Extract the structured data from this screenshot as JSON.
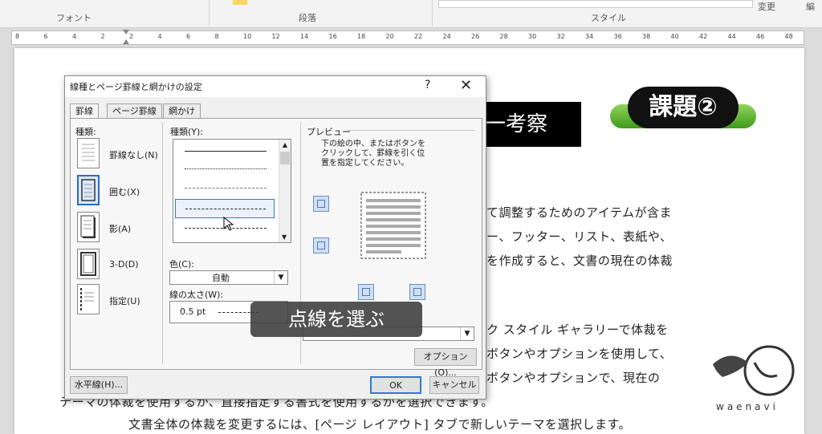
{
  "ribbon": {
    "group_font": "フォント",
    "group_paragraph": "段落",
    "group_style": "スタイル",
    "change_label": "変更",
    "edit_label": "編"
  },
  "ruler": [
    "8",
    "6",
    "4",
    "2",
    "2",
    "4",
    "6",
    "8",
    "10",
    "12",
    "14",
    "16",
    "18",
    "20",
    "22",
    "24",
    "26",
    "28",
    "30",
    "32",
    "34",
    "36",
    "38",
    "40",
    "42",
    "44",
    "46",
    "48"
  ],
  "document": {
    "title_partial": "一考察",
    "badge": "課題②",
    "lines": [
      "て調整するためのアイテムが含ま",
      "ー、フッター、リスト、表紙や、",
      "を作成すると、文書の現在の体裁",
      "ク スタイル ギャラリーで体裁を",
      "ボタンやオプションを使用して、",
      "ボタンやオプションで、現在の",
      "テーマの体裁を使用するか、直接指定する書式を使用するかを選択できます。",
      "文書全体の体裁を変更するには、[ページ レイアウト] タブで新しいテーマを選択します。"
    ]
  },
  "logo": {
    "text": "waenavi"
  },
  "dialog": {
    "title": "線種とページ罫線と網かけの設定",
    "help": "?",
    "close": "✕",
    "tabs": [
      "罫線",
      "ページ罫線",
      "網かけ"
    ],
    "settings_label": "種類:",
    "settings": [
      "罫線なし(N)",
      "囲む(X)",
      "影(A)",
      "3-D(D)",
      "指定(U)"
    ],
    "style_label": "種類(Y):",
    "color_label": "色(C):",
    "color_value": "自動",
    "width_label": "線の太さ(W):",
    "width_value": "0.5 pt",
    "preview_label": "プレビュー",
    "preview_hint": [
      "下の絵の中、またはボタンを",
      "クリックして、罫線を引く位",
      "置を指定してください。"
    ],
    "options_button": "オプション(O)...",
    "horizontal_button": "水平線(H)...",
    "ok_button": "OK",
    "cancel_button": "キャンセル"
  },
  "subtitle": "点線を選ぶ"
}
